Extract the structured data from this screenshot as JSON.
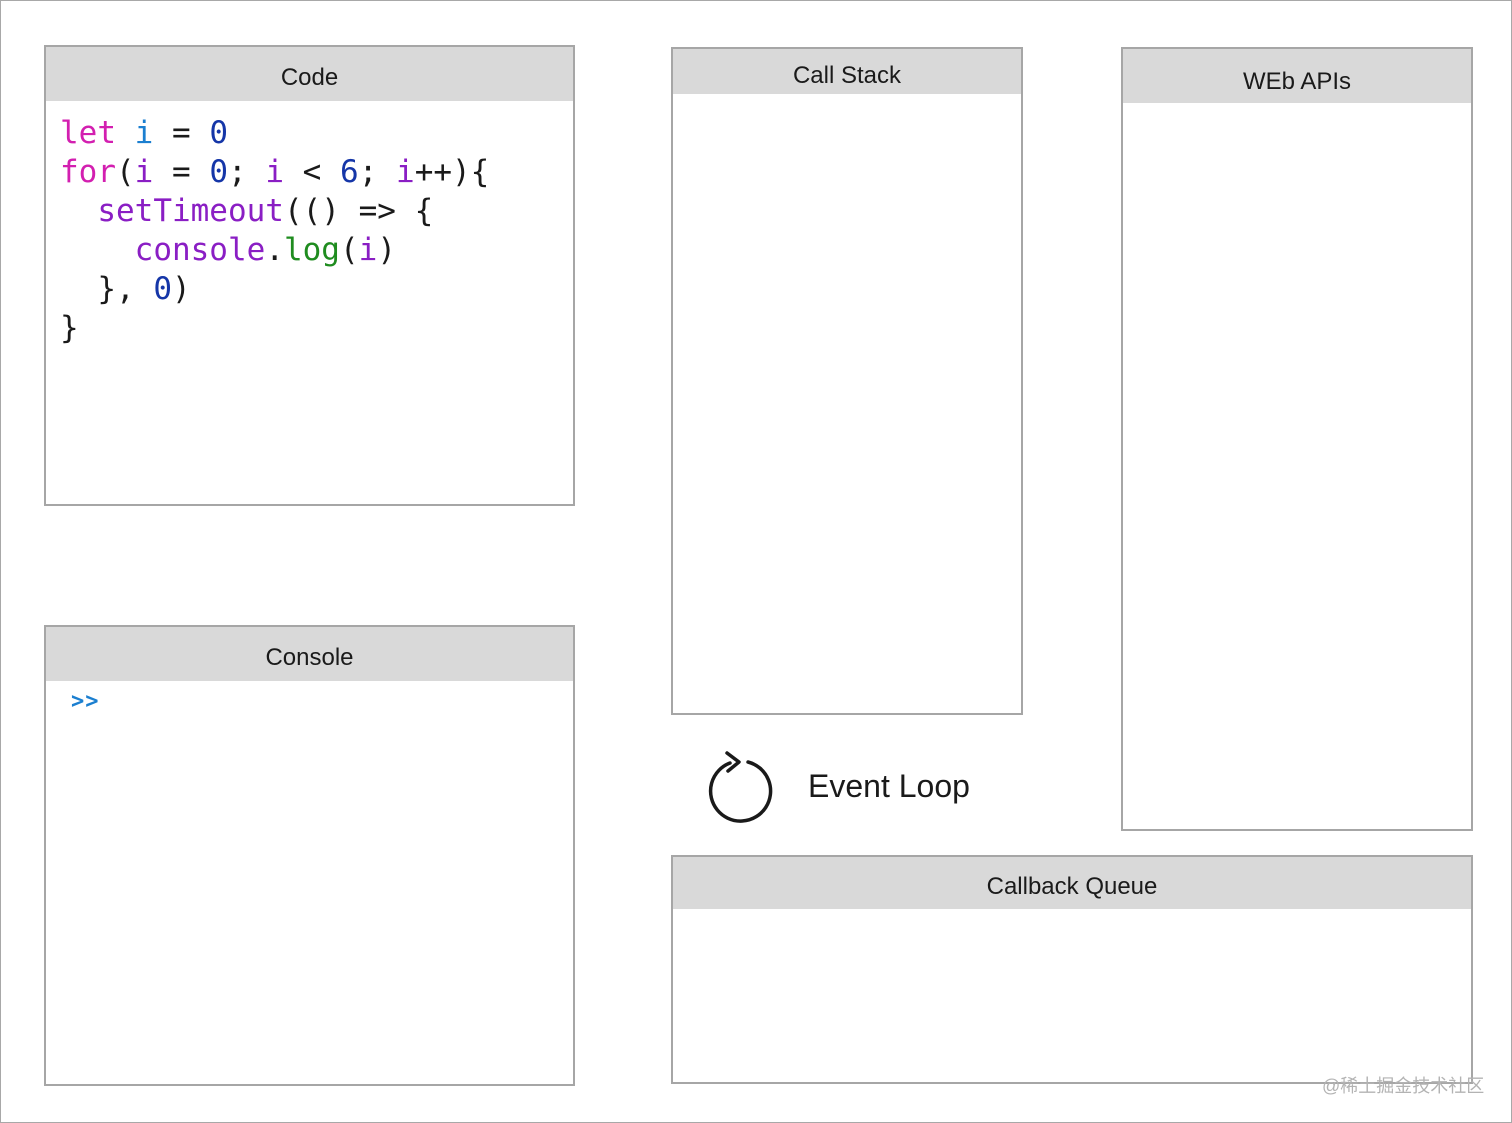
{
  "panels": {
    "code": {
      "title": "Code"
    },
    "console": {
      "title": "Console",
      "prompt": ">>"
    },
    "call_stack": {
      "title": "Call Stack"
    },
    "web_apis": {
      "title": "WEb APIs"
    },
    "callback_queue": {
      "title": "Callback Queue"
    }
  },
  "code_lines": [
    [
      {
        "t": "let",
        "c": "kw"
      },
      {
        "t": " ",
        "c": "pl"
      },
      {
        "t": "i",
        "c": "var"
      },
      {
        "t": " = ",
        "c": "pl"
      },
      {
        "t": "0",
        "c": "num"
      }
    ],
    [
      {
        "t": "for",
        "c": "kw"
      },
      {
        "t": "(",
        "c": "pl"
      },
      {
        "t": "i",
        "c": "fn"
      },
      {
        "t": " = ",
        "c": "pl"
      },
      {
        "t": "0",
        "c": "num"
      },
      {
        "t": "; ",
        "c": "pl"
      },
      {
        "t": "i",
        "c": "fn"
      },
      {
        "t": " < ",
        "c": "pl"
      },
      {
        "t": "6",
        "c": "num"
      },
      {
        "t": "; ",
        "c": "pl"
      },
      {
        "t": "i",
        "c": "fn"
      },
      {
        "t": "++){",
        "c": "pl"
      }
    ],
    [
      {
        "t": "  ",
        "c": "pl"
      },
      {
        "t": "setTimeout",
        "c": "fn"
      },
      {
        "t": "(() => {",
        "c": "pl"
      }
    ],
    [
      {
        "t": "    ",
        "c": "pl"
      },
      {
        "t": "console",
        "c": "fn"
      },
      {
        "t": ".",
        "c": "pl"
      },
      {
        "t": "log",
        "c": "mth"
      },
      {
        "t": "(",
        "c": "pl"
      },
      {
        "t": "i",
        "c": "fn"
      },
      {
        "t": ")",
        "c": "pl"
      }
    ],
    [
      {
        "t": "  }, ",
        "c": "pl"
      },
      {
        "t": "0",
        "c": "num"
      },
      {
        "t": ")",
        "c": "pl"
      }
    ],
    [
      {
        "t": "}",
        "c": "pl"
      }
    ]
  ],
  "event_loop": {
    "label": "Event Loop",
    "icon": "refresh-icon"
  },
  "watermark": "@稀土掘金技术社区",
  "colors": {
    "keyword": "#d31fb0",
    "variable": "#1b7fd0",
    "number": "#1536a8",
    "function": "#8a1ec4",
    "method": "#1f8c1f",
    "prompt": "#1b7fd0",
    "header_bg": "#d9d9d9",
    "border": "#a6a6a6"
  }
}
